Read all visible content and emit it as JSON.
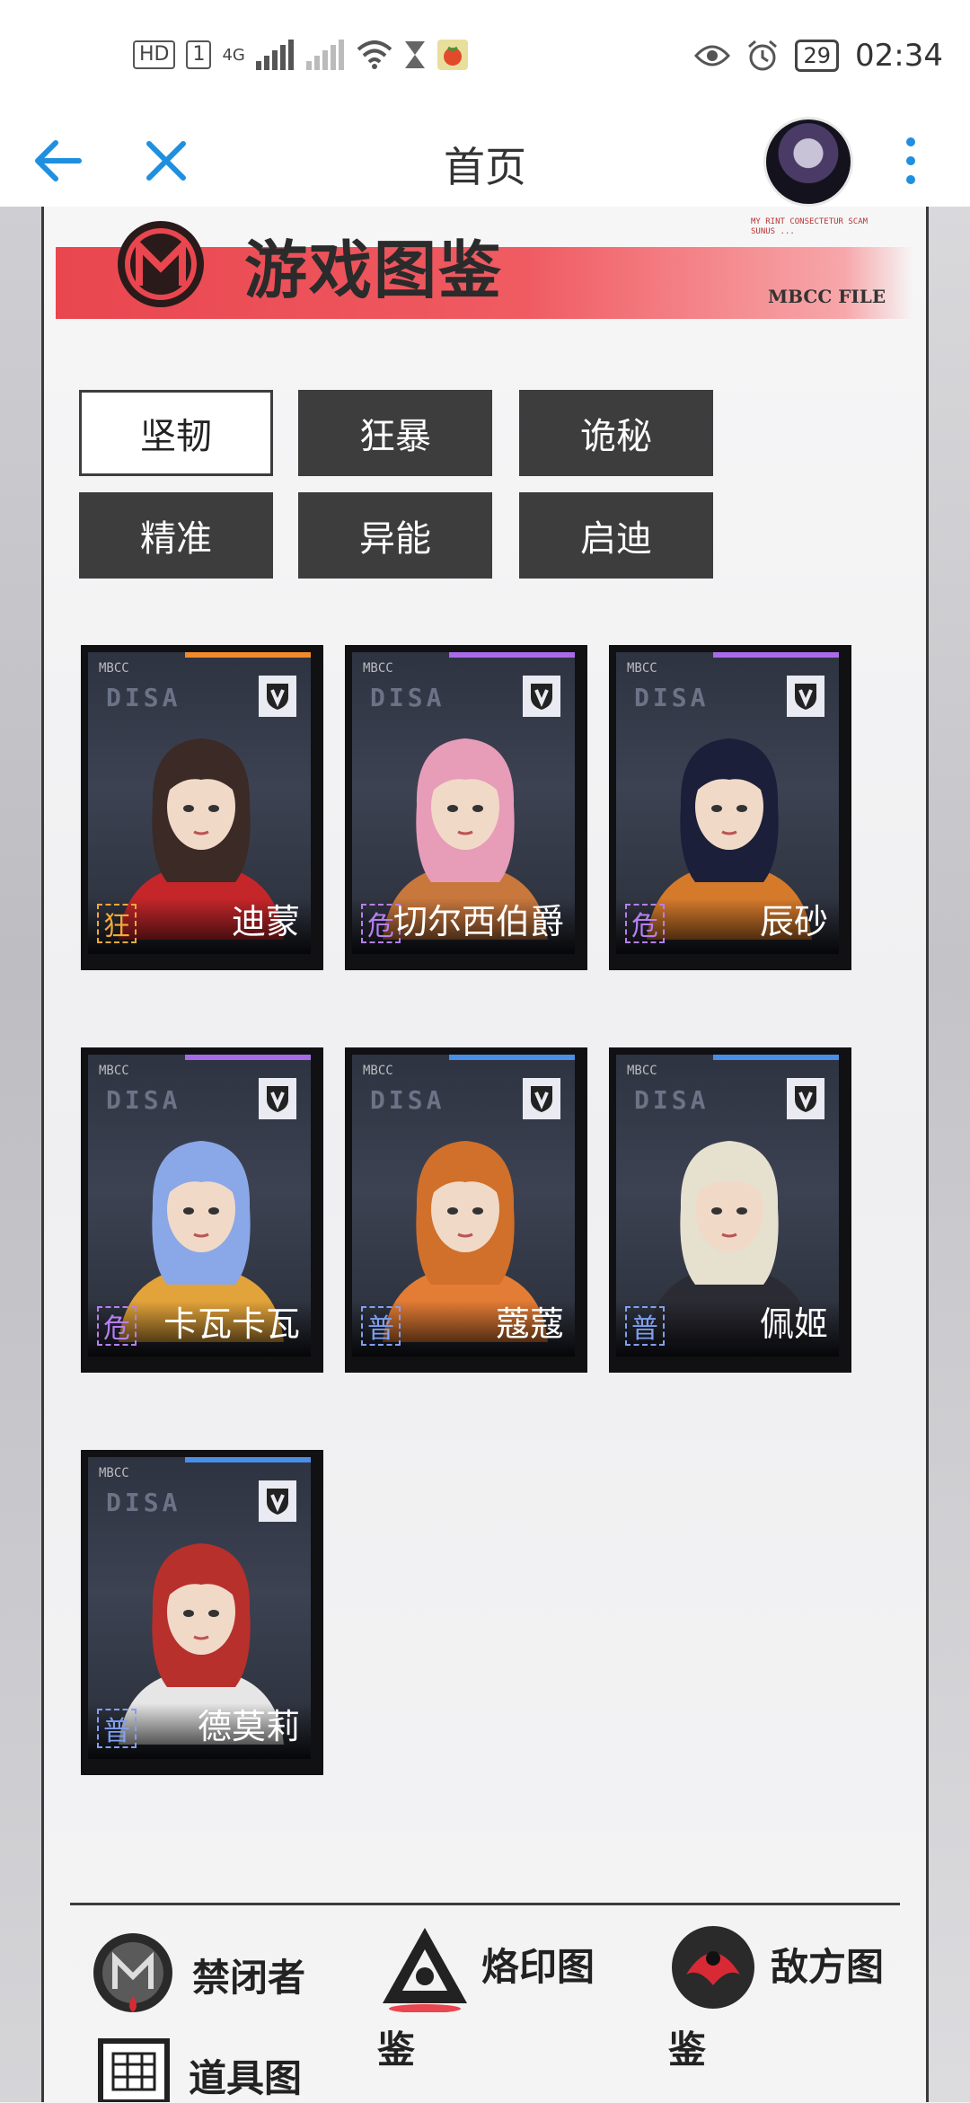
{
  "status_bar": {
    "network": "4G",
    "hd": "HD",
    "sim": "1",
    "battery": "29",
    "time": "02:34"
  },
  "app_bar": {
    "title": "首页"
  },
  "header": {
    "title": "游戏图鉴",
    "tag": "MBCC FILE",
    "small_text": "MY RINT CONSECTETUR SCAM SUNUS ..."
  },
  "filters": [
    {
      "label": "坚韧",
      "active": true
    },
    {
      "label": "狂暴",
      "active": false
    },
    {
      "label": "诡秘",
      "active": false
    },
    {
      "label": "精准",
      "active": false
    },
    {
      "label": "异能",
      "active": false
    },
    {
      "label": "启迪",
      "active": false
    }
  ],
  "cards": [
    {
      "name": "迪蒙",
      "rank": "狂",
      "stripe": "orange",
      "hair": "#3b2a26",
      "outfit": "#c4262a"
    },
    {
      "name": "切尔西伯爵",
      "rank": "危",
      "stripe": "purple",
      "hair": "#e79cb8",
      "outfit": "#c8773d"
    },
    {
      "name": "辰砂",
      "rank": "危",
      "stripe": "purple",
      "hair": "#1b1f3a",
      "outfit": "#d57a2b"
    },
    {
      "name": "卡瓦卡瓦",
      "rank": "危",
      "stripe": "purple",
      "hair": "#8aa7e8",
      "outfit": "#e2a33a"
    },
    {
      "name": "蔻蔻",
      "rank": "普",
      "stripe": "blue",
      "hair": "#d0702b",
      "outfit": "#e37c34"
    },
    {
      "name": "佩姬",
      "rank": "普",
      "stripe": "blue",
      "hair": "#e6e0cf",
      "outfit": "#2b2b33"
    },
    {
      "name": "德莫莉",
      "rank": "普",
      "stripe": "blue",
      "hair": "#b8302b",
      "outfit": "#e6e6e6"
    }
  ],
  "card_brand": "MBCC",
  "card_logo": "DISA",
  "bottom_nav": [
    {
      "label": "禁闭者",
      "icon": "prisoner-emblem-icon"
    },
    {
      "label": "烙印图",
      "icon": "brand-triangle-icon"
    },
    {
      "label": "鉴",
      "icon": ""
    },
    {
      "label": "敌方图",
      "icon": "enemy-emblem-icon"
    },
    {
      "label": "鉴",
      "icon": ""
    },
    {
      "label": "道具图",
      "icon": "item-box-icon"
    }
  ],
  "colors": {
    "accent_blue": "#1f8fe0",
    "banner_red": "#ee4a52",
    "chip_dark": "#3d3d3d"
  }
}
